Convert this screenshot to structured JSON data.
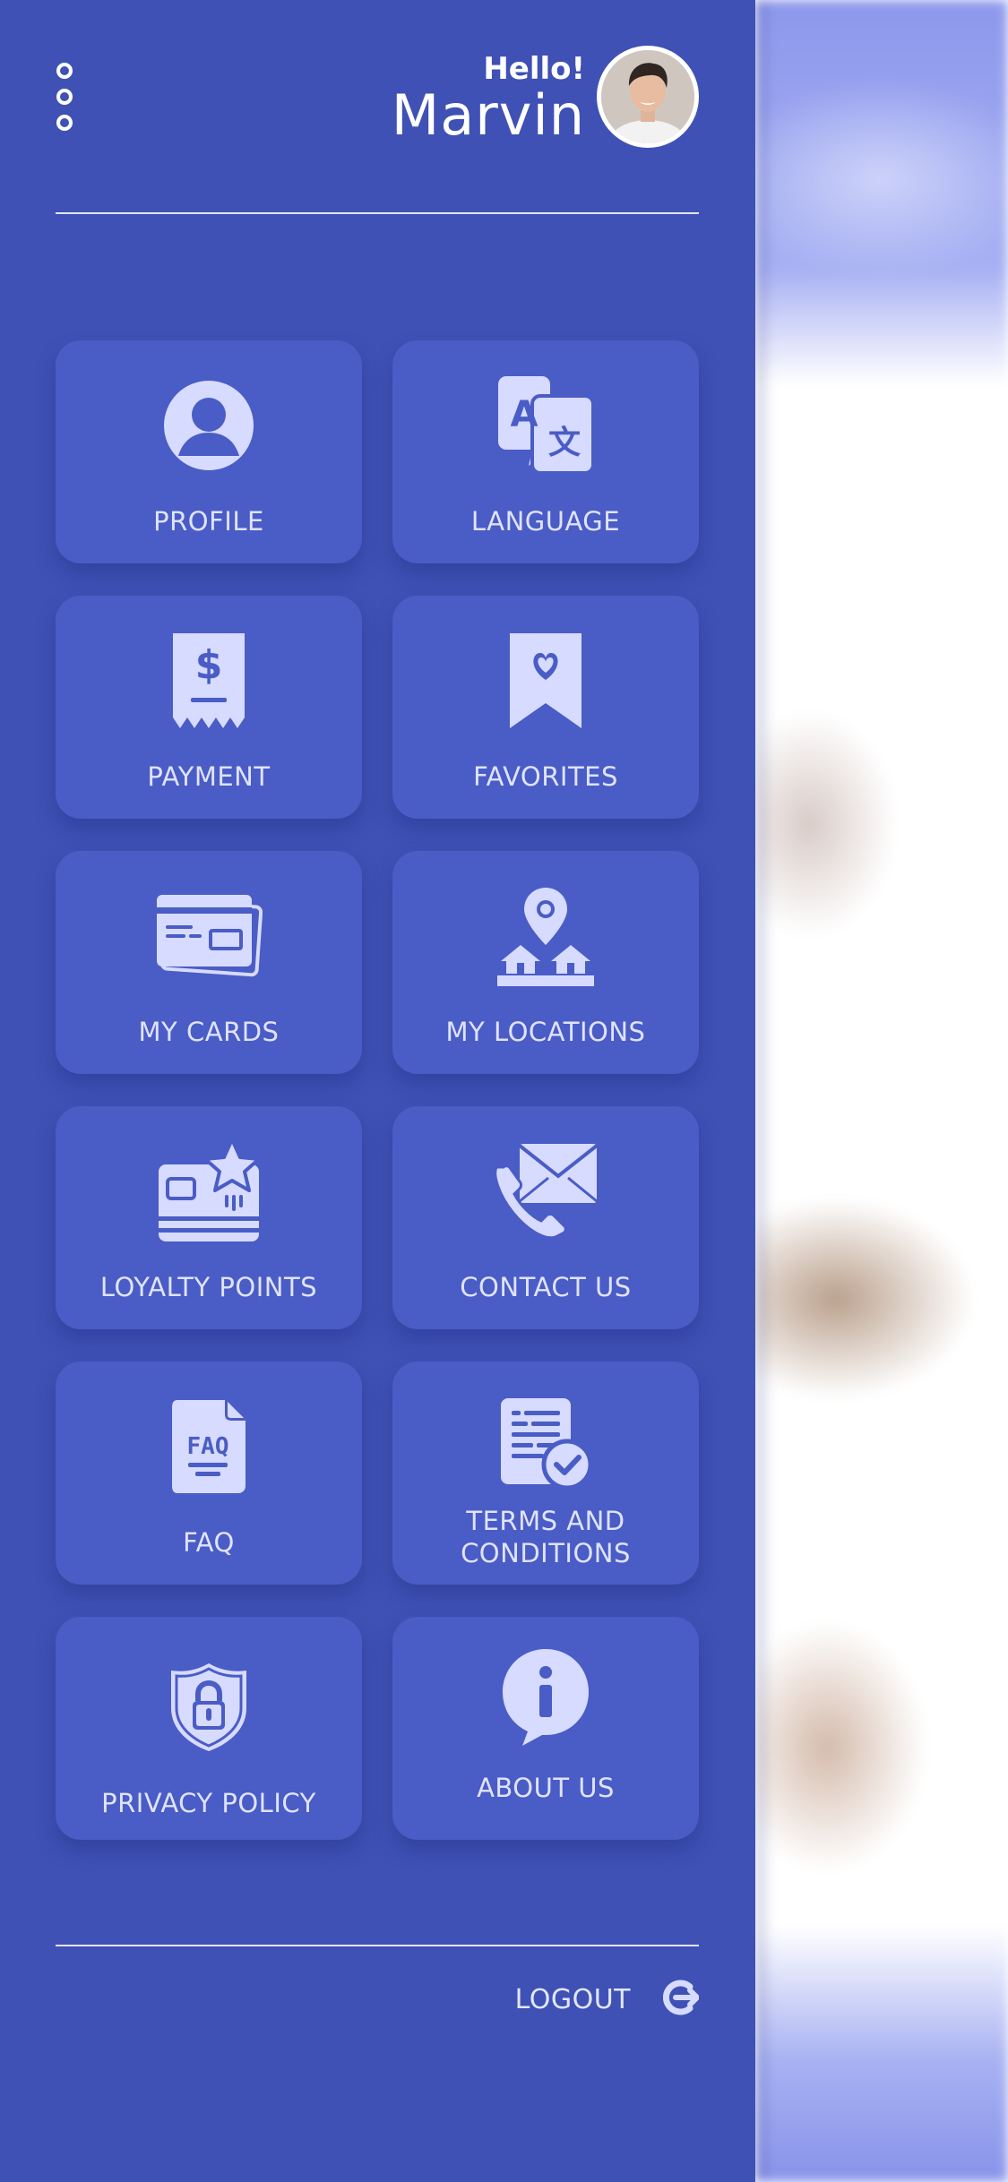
{
  "header": {
    "menu_icon": "three-dots-vertical-icon",
    "greeting": "Hello!",
    "user_name": "Marvin",
    "avatar_icon": "user-avatar"
  },
  "menu": {
    "items": [
      {
        "label": "PROFILE",
        "icon": "user-circle-icon"
      },
      {
        "label": "LANGUAGE",
        "icon": "translate-icon"
      },
      {
        "label": "PAYMENT",
        "icon": "receipt-dollar-icon"
      },
      {
        "label": "FAVORITES",
        "icon": "bookmark-heart-icon"
      },
      {
        "label": "MY CARDS",
        "icon": "credit-cards-icon"
      },
      {
        "label": "MY LOCATIONS",
        "icon": "map-pin-houses-icon"
      },
      {
        "label": "LOYALTY POINTS",
        "icon": "card-star-icon"
      },
      {
        "label": "CONTACT US",
        "icon": "phone-envelope-icon"
      },
      {
        "label": "FAQ",
        "icon": "faq-document-icon"
      },
      {
        "label": "TERMS AND CONDITIONS",
        "label_line1": "TERMS AND",
        "label_line2": "CONDITIONS",
        "icon": "document-check-icon"
      },
      {
        "label": "PRIVACY POLICY",
        "icon": "shield-lock-icon"
      },
      {
        "label": "ABOUT US",
        "icon": "info-bubble-icon"
      }
    ]
  },
  "footer": {
    "logout_label": "LOGOUT",
    "logout_icon": "logout-icon"
  },
  "colors": {
    "drawer_bg": "#3f51b5",
    "tile_bg": "#4a5cc5",
    "icon_fill": "#d6dbff",
    "text": "#ffffff"
  }
}
